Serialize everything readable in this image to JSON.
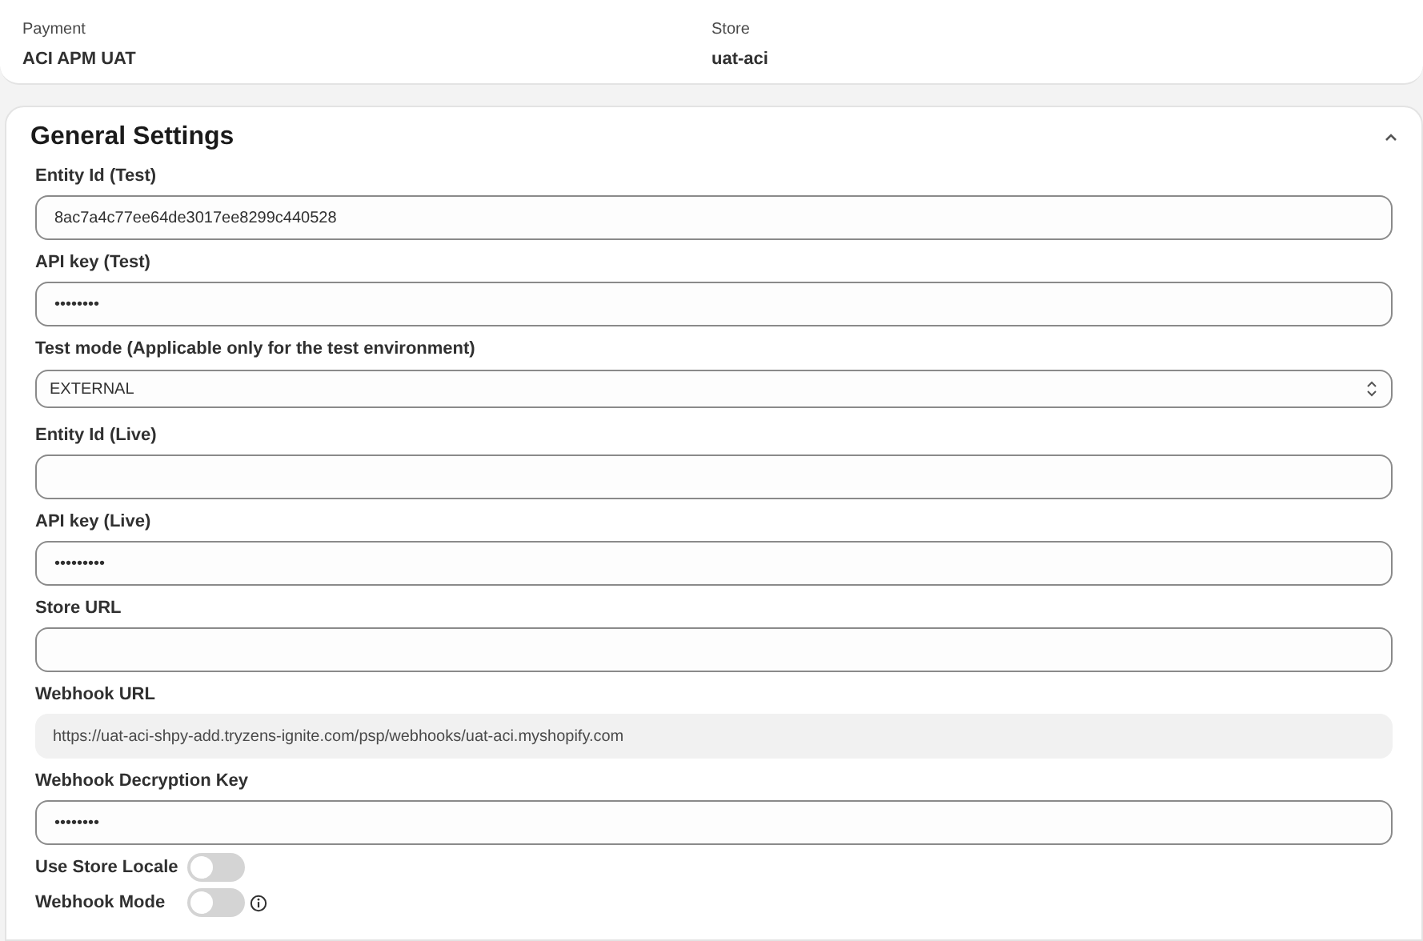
{
  "summary": [
    {
      "label": "Payment",
      "value": "ACI APM UAT"
    },
    {
      "label": "Store",
      "value": "uat-aci"
    }
  ],
  "section": {
    "title": "General Settings",
    "expanded": true,
    "fields": [
      {
        "kind": "text",
        "label": "Entity Id (Test)",
        "value": "8ac7a4c77ee64de3017ee8299c440528"
      },
      {
        "kind": "text",
        "label": "API key (Test)",
        "value": "••••••••"
      },
      {
        "kind": "select",
        "label": "Test mode (Applicable only for the test environment)",
        "value": "EXTERNAL"
      },
      {
        "kind": "text",
        "label": "Entity Id (Live)"
      },
      {
        "kind": "text",
        "label": "API key (Live)",
        "value": "•••••••••"
      },
      {
        "kind": "text",
        "label": "Store URL"
      },
      {
        "kind": "readonly",
        "label": "Webhook URL",
        "value": "https://uat-aci-shpy-add.tryzens-ignite.com/psp/webhooks/uat-aci.myshopify.com"
      },
      {
        "kind": "text",
        "label": "Webhook Decryption Key",
        "value": "••••••••"
      }
    ],
    "toggles": [
      {
        "label": "Use Store Locale",
        "on": false,
        "info": false
      },
      {
        "label": "Webhook Mode",
        "on": false,
        "info": true
      }
    ]
  }
}
